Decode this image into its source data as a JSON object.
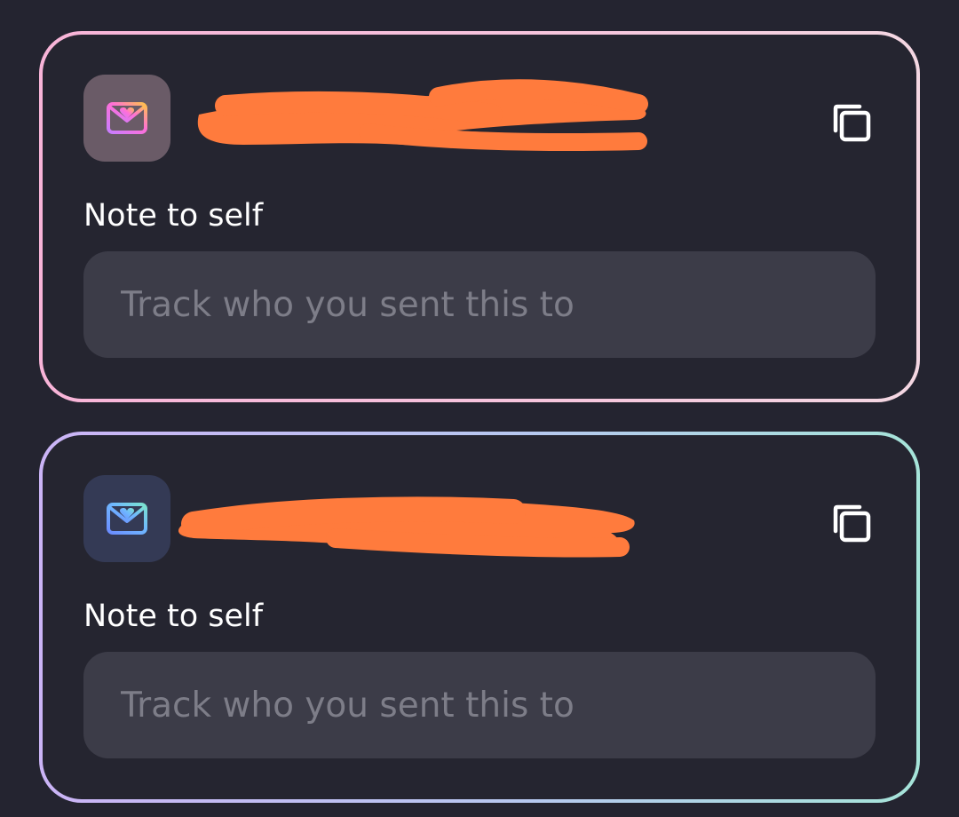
{
  "cards": [
    {
      "note_label": "Note to self",
      "note_placeholder": "Track who you sent this to",
      "note_value": "",
      "avatar_icon": "heart-mail-icon",
      "copy_icon": "copy-icon",
      "border_colors": [
        "#f7b6d6",
        "#f3d2e2"
      ],
      "avatar_bg": "#6a5b67",
      "icon_colors": [
        "#ff6fd8",
        "#ffb347"
      ]
    },
    {
      "note_label": "Note to self",
      "note_placeholder": "Track who you sent this to",
      "note_value": "",
      "avatar_icon": "heart-mail-icon",
      "copy_icon": "copy-icon",
      "border_colors": [
        "#c8b4f4",
        "#a8e3d8"
      ],
      "avatar_bg": "#343a55",
      "icon_colors": [
        "#6aa6ff",
        "#7be0d2"
      ]
    }
  ],
  "redaction_color": "#ff7b3d"
}
